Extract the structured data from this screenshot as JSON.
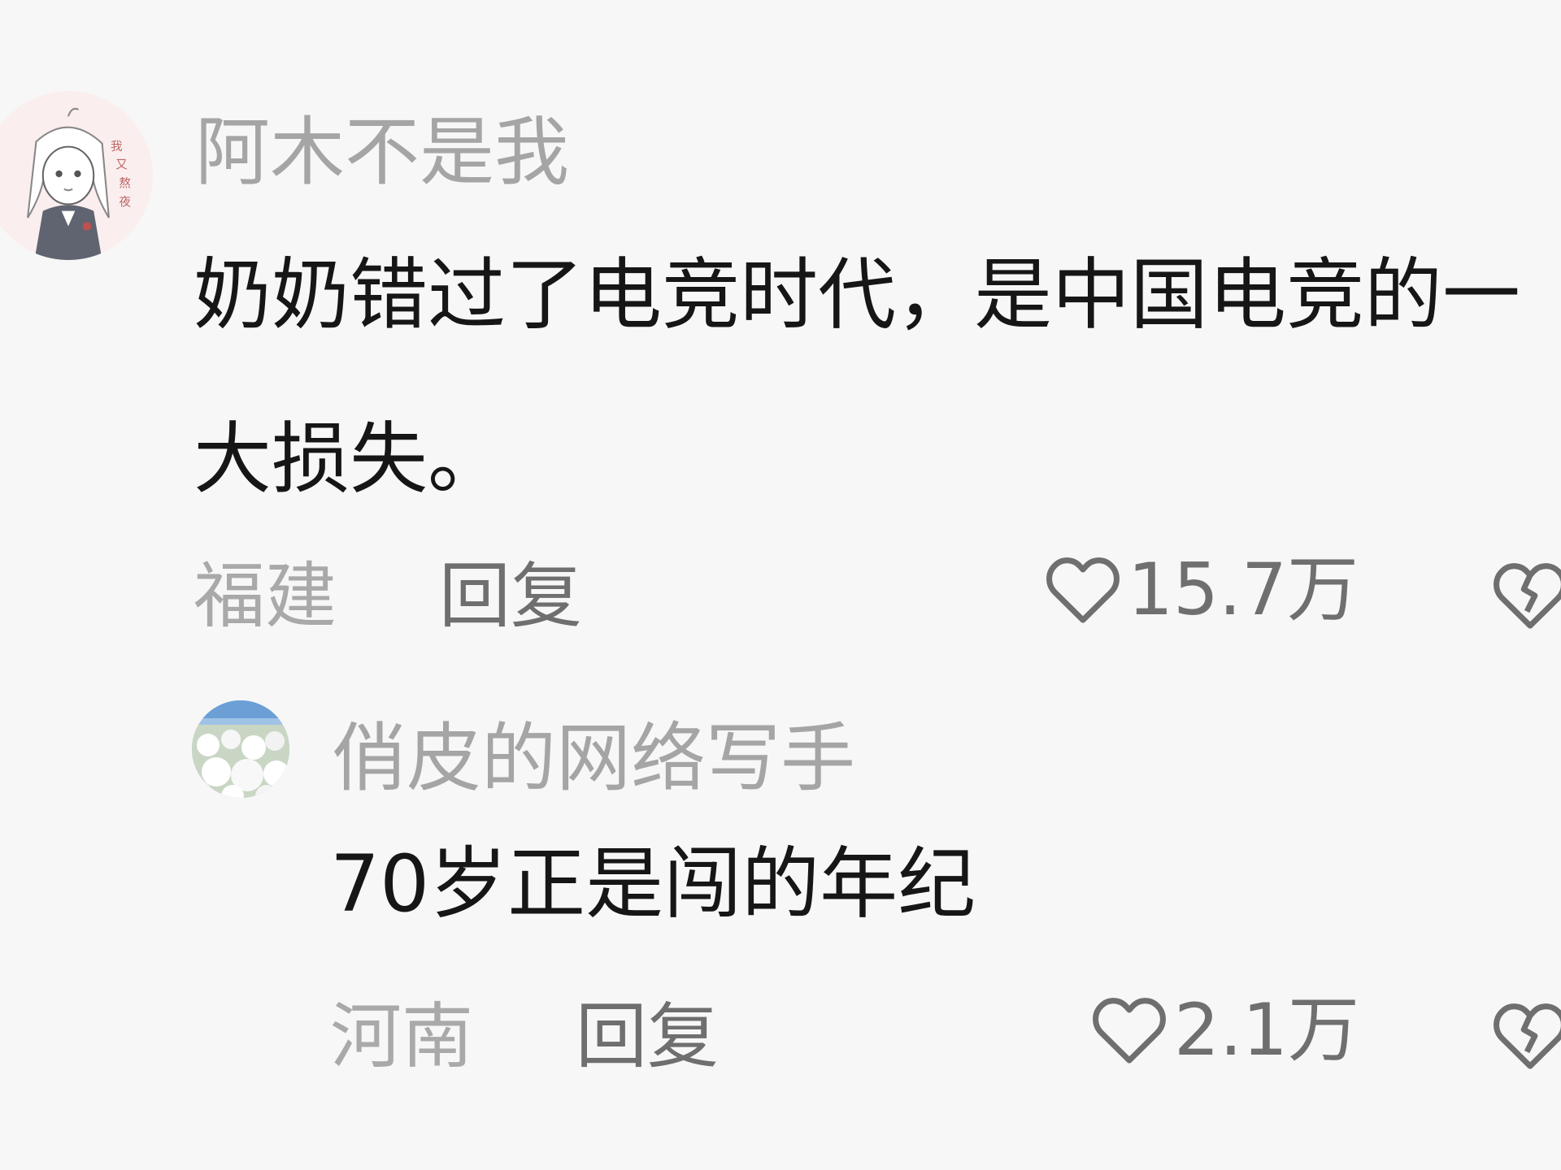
{
  "comments": [
    {
      "username": "阿木不是我",
      "text": "奶奶错过了电竞时代，是中国电竞的一大损失。",
      "location": "福建",
      "reply_label": "回复",
      "likes": "15.7万",
      "avatar_icon": "anime-girl-avatar-icon"
    },
    {
      "username": "俏皮的网络写手",
      "text": "70岁正是闯的年纪",
      "location": "河南",
      "reply_label": "回复",
      "likes": "2.1万",
      "avatar_icon": "flower-field-avatar-icon"
    }
  ],
  "icons": {
    "like": "heart-outline-icon",
    "dislike": "broken-heart-icon"
  },
  "colors": {
    "background": "#f7f7f7",
    "username": "#a5a5a5",
    "text": "#161616",
    "meta": "#6f6f6f"
  }
}
